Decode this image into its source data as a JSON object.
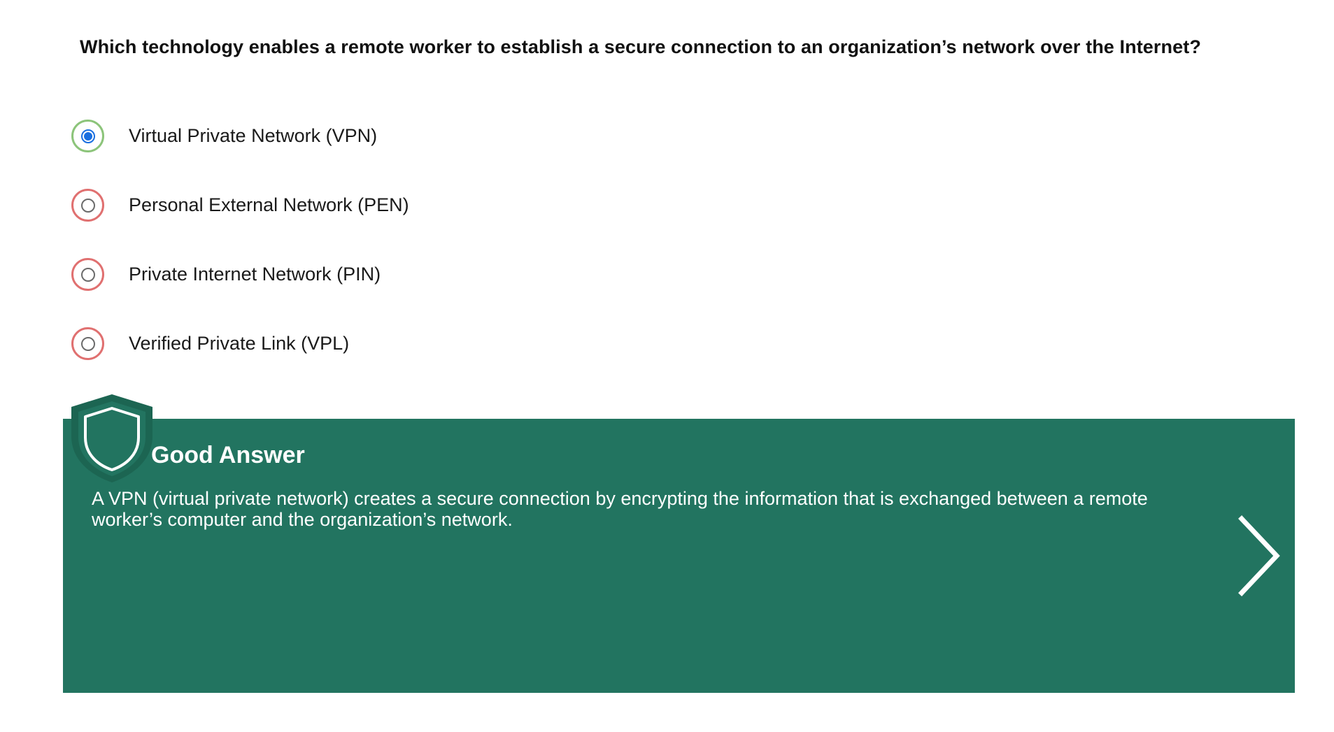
{
  "question": {
    "text": "Which technology enables a remote worker to establish a secure connection to an organization’s network over the Internet?"
  },
  "options": [
    {
      "label": "Virtual Private Network (VPN)",
      "selected": true,
      "status": "correct"
    },
    {
      "label": "Personal External Network (PEN)",
      "selected": false,
      "status": "incorrect"
    },
    {
      "label": "Private Internet Network (PIN)",
      "selected": false,
      "status": "incorrect"
    },
    {
      "label": "Verified Private Link (VPL)",
      "selected": false,
      "status": "incorrect"
    }
  ],
  "feedback": {
    "title": "Good Answer",
    "text": "A VPN (virtual private network) creates a secure connection by encrypting the information that is exchanged between a remote worker’s computer and the organization’s network.",
    "icon": "shield-icon",
    "next_icon": "chevron-right-icon"
  },
  "colors": {
    "panel": "#227460",
    "correct_ring": "#8cc47a",
    "incorrect_ring": "#e07070",
    "radio_checked": "#1a6fe0"
  }
}
